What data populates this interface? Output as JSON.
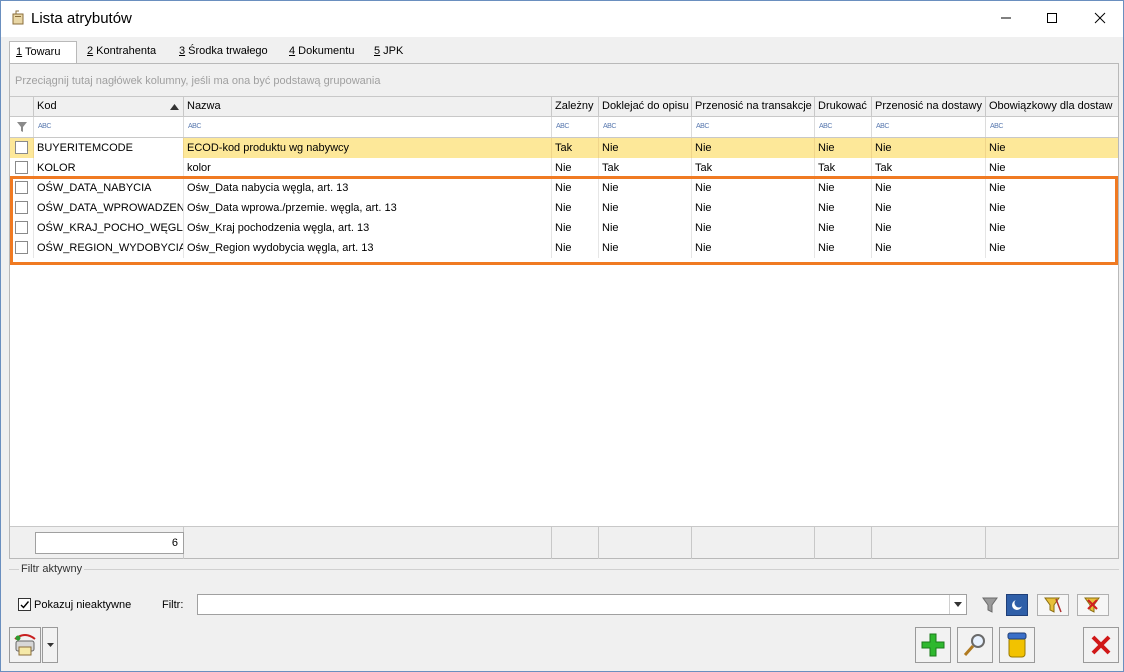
{
  "window": {
    "title": "Lista atrybutów"
  },
  "tabs": [
    {
      "key": "1",
      "label": " Towaru"
    },
    {
      "key": "2",
      "label": " Kontrahenta"
    },
    {
      "key": "3",
      "label": " Środka trwałego"
    },
    {
      "key": "4",
      "label": " Dokumentu"
    },
    {
      "key": "5",
      "label": " JPK"
    }
  ],
  "grid": {
    "group_hint": "Przeciągnij tutaj nagłówek kolumny, jeśli ma ona być podstawą grupowania",
    "filter_icon_text": "ABC",
    "columns": [
      "Kod",
      "Nazwa",
      "Zależny",
      "Doklejać do opisu",
      "Przenosić na transakcje",
      "Drukować",
      "Przenosić na dostawy",
      "Obowiązkowy dla dostaw"
    ],
    "rows": [
      [
        "BUYERITEMCODE",
        "ECOD-kod produktu wg nabywcy",
        "Tak",
        "Nie",
        "Nie",
        "Nie",
        "Nie",
        "Nie"
      ],
      [
        "KOLOR",
        "kolor",
        "Nie",
        "Tak",
        "Tak",
        "Tak",
        "Tak",
        "Nie"
      ],
      [
        "OŚW_DATA_NABYCIA",
        "Ośw_Data nabycia węgla, art. 13",
        "Nie",
        "Nie",
        "Nie",
        "Nie",
        "Nie",
        "Nie"
      ],
      [
        "OŚW_DATA_WPROWADZENI",
        "Ośw_Data wprowa./przemie. węgla, art. 13",
        "Nie",
        "Nie",
        "Nie",
        "Nie",
        "Nie",
        "Nie"
      ],
      [
        "OŚW_KRAJ_POCHO_WĘGLA",
        "Ośw_Kraj pochodzenia węgla, art. 13",
        "Nie",
        "Nie",
        "Nie",
        "Nie",
        "Nie",
        "Nie"
      ],
      [
        "OŚW_REGION_WYDOBYCIA",
        "Ośw_Region wydobycia węgla, art. 13",
        "Nie",
        "Nie",
        "Nie",
        "Nie",
        "Nie",
        "Nie"
      ]
    ],
    "row_count": "6"
  },
  "filter_panel": {
    "title": "Filtr aktywny",
    "show_inactive_label": "Pokazuj nieaktywne",
    "filter_label": "Filtr:",
    "filter_value": ""
  },
  "colors": {
    "selected_row": "#fde899",
    "highlight": "#f07a22"
  }
}
